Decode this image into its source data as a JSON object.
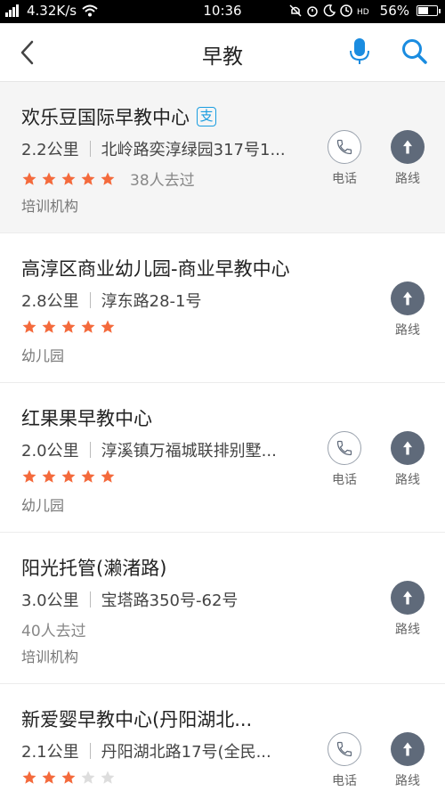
{
  "status_bar": {
    "signal": "4G",
    "net_speed": "4.32K/s",
    "time": "10:36",
    "battery": "56%",
    "battery_level": 0.56
  },
  "nav": {
    "title": "早教"
  },
  "labels": {
    "call": "电话",
    "route": "路线"
  },
  "colors": {
    "star_on": "#f46a3c",
    "star_off": "#dddddd",
    "accent_blue": "#1a8ce0",
    "route_bg": "#5f6a7a"
  },
  "items": [
    {
      "name": "欢乐豆国际早教中心",
      "alipay_badge": "支",
      "distance": "2.2公里",
      "address": "北岭路奕淳绿园317号1...",
      "stars": 5,
      "visits": "38人去过",
      "category": "培训机构",
      "has_call": true
    },
    {
      "name": "高淳区商业幼儿园-商业早教中心",
      "distance": "2.8公里",
      "address": "淳东路28-1号",
      "stars": 5,
      "visits": "",
      "category": "幼儿园",
      "has_call": false
    },
    {
      "name": "红果果早教中心",
      "distance": "2.0公里",
      "address": "淳溪镇万福城联排别墅...",
      "stars": 5,
      "visits": "",
      "category": "幼儿园",
      "has_call": true
    },
    {
      "name": "阳光托管(濑渚路)",
      "distance": "3.0公里",
      "address": "宝塔路350号-62号",
      "stars": 0,
      "visits": "40人去过",
      "category": "培训机构",
      "has_call": false
    },
    {
      "name": "新爱婴早教中心(丹阳湖北...",
      "distance": "2.1公里",
      "address": "丹阳湖北路17号(全民...",
      "stars": 3,
      "visits": "",
      "category": "",
      "has_call": true
    }
  ]
}
